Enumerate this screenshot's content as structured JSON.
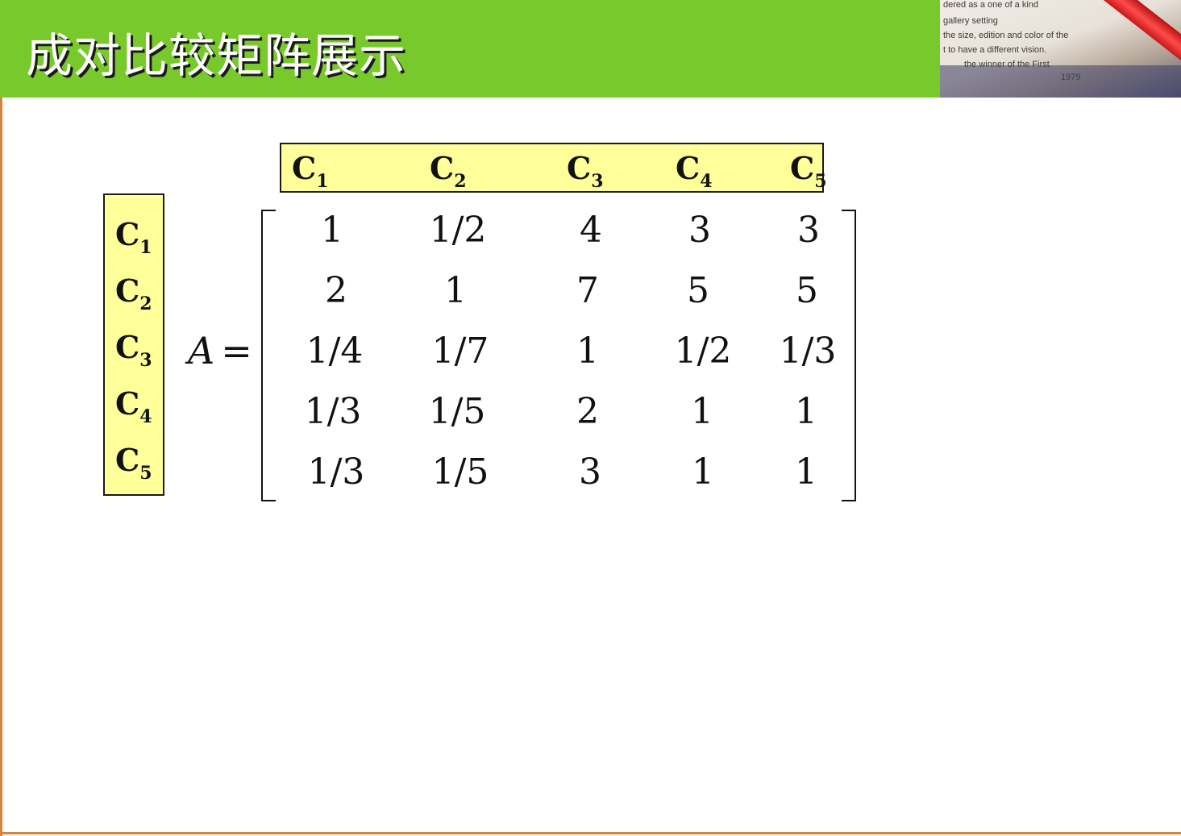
{
  "slide": {
    "title": "成对比较矩阵展示",
    "photo_lines": [
      "dered as  a one of a kind",
      "gallery setting",
      "the size, edition and color of the",
      "t to have a different vision.",
      "the winner of the First",
      "1979"
    ]
  },
  "criteria": {
    "columns": [
      {
        "base": "C",
        "sub": "1"
      },
      {
        "base": "C",
        "sub": "2"
      },
      {
        "base": "C",
        "sub": "3"
      },
      {
        "base": "C",
        "sub": "4"
      },
      {
        "base": "C",
        "sub": "5"
      }
    ],
    "rows": [
      {
        "base": "C",
        "sub": "1"
      },
      {
        "base": "C",
        "sub": "2"
      },
      {
        "base": "C",
        "sub": "3"
      },
      {
        "base": "C",
        "sub": "4"
      },
      {
        "base": "C",
        "sub": "5"
      }
    ]
  },
  "matrix": {
    "label": "A",
    "equals": "=",
    "rows": [
      [
        "1",
        "1/2",
        "4",
        "3",
        "3"
      ],
      [
        "2",
        "1",
        "7",
        "5",
        "5"
      ],
      [
        "1/4",
        "1/7",
        "1",
        "1/2",
        "1/3"
      ],
      [
        "1/3",
        "1/5",
        "2",
        "1",
        "1"
      ],
      [
        "1/3",
        "1/5",
        "3",
        "1",
        "1"
      ]
    ]
  }
}
